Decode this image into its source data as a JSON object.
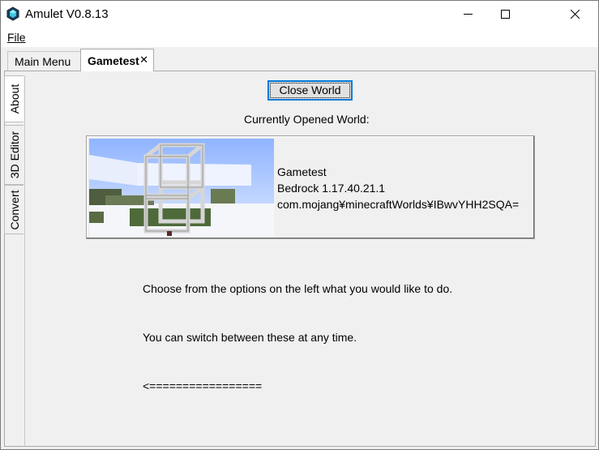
{
  "window": {
    "title": "Amulet V0.8.13",
    "icon": "amulet-cube-icon"
  },
  "menu": {
    "file": "File"
  },
  "tabs": [
    {
      "label": "Main Menu",
      "active": false
    },
    {
      "label": "Gametest",
      "active": true,
      "close_glyph": "✕"
    }
  ],
  "side_tabs": [
    "About",
    "3D Editor",
    "Convert"
  ],
  "panel": {
    "close_button": "Close World",
    "opened_label": "Currently Opened World:",
    "world": {
      "name": "Gametest",
      "version": "Bedrock 1.17.40.21.1",
      "path": "com.mojang¥minecraftWorlds¥IBwvYHH2SQA="
    },
    "instructions": [
      "Choose from the options on the left what you would like to do.",
      "You can switch between these at any time.",
      "<================="
    ]
  },
  "colors": {
    "accent": "#0078d7",
    "window_bg": "#f0f0f0"
  }
}
